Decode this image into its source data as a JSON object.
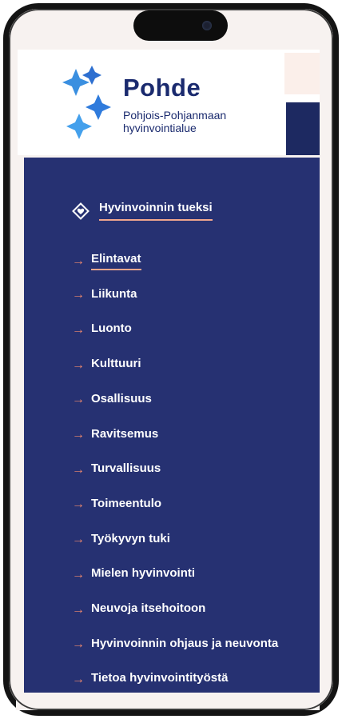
{
  "brand": {
    "name": "Pohde",
    "subtitle_line1": "Pohjois-Pohjanmaan",
    "subtitle_line2": "hyvinvointialue"
  },
  "menu": {
    "section_title": "Hyvinvoinnin tueksi",
    "items": [
      {
        "label": "Elintavat",
        "active": true
      },
      {
        "label": "Liikunta"
      },
      {
        "label": "Luonto"
      },
      {
        "label": "Kulttuuri"
      },
      {
        "label": "Osallisuus"
      },
      {
        "label": "Ravitsemus"
      },
      {
        "label": "Turvallisuus"
      },
      {
        "label": "Toimeentulo"
      },
      {
        "label": "Työkyvyn tuki"
      },
      {
        "label": "Mielen hyvinvointi"
      },
      {
        "label": "Neuvoja itsehoitoon"
      },
      {
        "label": "Hyvinvoinnin ohjaus ja neuvonta"
      },
      {
        "label": "Tietoa hyvinvointityöstä"
      }
    ],
    "arrow_glyph": "→"
  },
  "colors": {
    "navy": "#263172",
    "accent": "#f08a6e",
    "brand_text": "#1a2a6e",
    "logo_blue": "#3a8fe0"
  }
}
